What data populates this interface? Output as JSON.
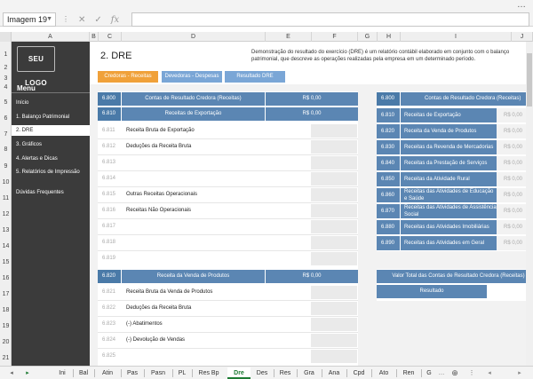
{
  "formula_bar": {
    "name_box": "Imagem 19",
    "formula": "",
    "cancel_glyph": "✕",
    "enter_glyph": "✓",
    "fx_glyph": "fx",
    "window_btn": "…"
  },
  "columns": [
    "A",
    "B",
    "C",
    "D",
    "E",
    "F",
    "G",
    "H",
    "I",
    "J"
  ],
  "row_numbers": [
    "1",
    "2",
    "3",
    "4",
    "5",
    "6",
    "7",
    "8",
    "9",
    "10",
    "11",
    "12",
    "13",
    "14",
    "15",
    "16",
    "17",
    "18",
    "19",
    "20",
    "21"
  ],
  "sidebar": {
    "logo": "SEU LOGO",
    "menu_title": "Menu",
    "items": [
      {
        "label": "Início"
      },
      {
        "label": "1. Balanço Patrimonial"
      },
      {
        "label": "2. DRE"
      },
      {
        "label": "3. Gráficos"
      },
      {
        "label": "4. Alertas e Dicas"
      },
      {
        "label": "5. Relatórios de Impressão"
      },
      {
        "label": "Dúvidas Frequentes"
      }
    ]
  },
  "page": {
    "title": "2. DRE",
    "description": "Demonstração do resultado do exercício (DRE) é um relatório contábil elaborado em conjunto com o balanço patrimonial, que descreve as operações realizadas pela empresa em um determinado período.",
    "tabs": [
      "Credoras - Receitas",
      "Devedoras - Despesas",
      "Resultado DRE"
    ]
  },
  "left_table": {
    "header": {
      "code": "6.800",
      "name": "Contas de Resultado Credora (Receitas)",
      "value": "R$ 0,00"
    },
    "group1": {
      "code": "6.810",
      "name": "Receitas de Exportação",
      "value": "R$ 0,00"
    },
    "group1_rows": [
      {
        "code": "6.811",
        "name": "Receita Bruta de Exportação"
      },
      {
        "code": "6.812",
        "name": "Deduções da Receita Bruta"
      },
      {
        "code": "6.813",
        "name": ""
      },
      {
        "code": "6.814",
        "name": ""
      },
      {
        "code": "6.815",
        "name": "Outras Receitas Operacionais"
      },
      {
        "code": "6.816",
        "name": "Receitas Não Operacionais"
      },
      {
        "code": "6.817",
        "name": ""
      },
      {
        "code": "6.818",
        "name": ""
      },
      {
        "code": "6.819",
        "name": ""
      }
    ],
    "group2": {
      "code": "6.820",
      "name": "Receita da Venda de Produtos",
      "value": "R$ 0,00"
    },
    "group2_rows": [
      {
        "code": "6.821",
        "name": "Receita Bruta da Venda de Produtos"
      },
      {
        "code": "6.822",
        "name": "Deduções da Receita Bruta"
      },
      {
        "code": "6.823",
        "name": "(-) Abatimentos"
      },
      {
        "code": "6.824",
        "name": "(-) Devolução de Vendas"
      },
      {
        "code": "6.825",
        "name": ""
      }
    ]
  },
  "right_table": {
    "header": {
      "code": "6.800",
      "name": "Contas de Resultado Credora (Receitas)"
    },
    "rows": [
      {
        "code": "6.810",
        "name": "Receitas de Exportação",
        "value": "R$ 0,00"
      },
      {
        "code": "6.820",
        "name": "Receita da Venda de Produtos",
        "value": "R$ 0,00"
      },
      {
        "code": "6.830",
        "name": "Receitas da Revenda de Mercadorias",
        "value": "R$ 0,00"
      },
      {
        "code": "6.840",
        "name": "Receitas da Prestação de Serviços",
        "value": "R$ 0,00"
      },
      {
        "code": "6.850",
        "name": "Receitas da Atividade Rural",
        "value": "R$ 0,00"
      },
      {
        "code": "6.860",
        "name": "Receitas das Atividades de Educação e Saúde",
        "value": "R$ 0,00"
      },
      {
        "code": "6.870",
        "name": "Receitas das Atividades de Assistência Social",
        "value": "R$ 0,00"
      },
      {
        "code": "6.880",
        "name": "Receitas das Atividades Imobiliárias",
        "value": "R$ 0,00"
      },
      {
        "code": "6.890",
        "name": "Receitas das Atividades em Geral",
        "value": "R$ 0,00"
      }
    ],
    "total_label": "Valor Total das Contas de Resultado Credora (Receitas)",
    "result_label": "Resultado"
  },
  "sheet_tabs": [
    "Ini",
    "Bal",
    "Atin",
    "Pas",
    "Pasn",
    "PL",
    "Res Bp",
    "Dre",
    "Des",
    "Res",
    "Gra",
    "Ana",
    "Cpd",
    "Ato",
    "Ren",
    "G"
  ],
  "active_sheet": "Dre",
  "colors": {
    "sidebar": "#3b3b3b",
    "accent_orange": "#f0a13a",
    "accent_blue": "#5b86b3",
    "excel_green": "#1e7b34"
  }
}
